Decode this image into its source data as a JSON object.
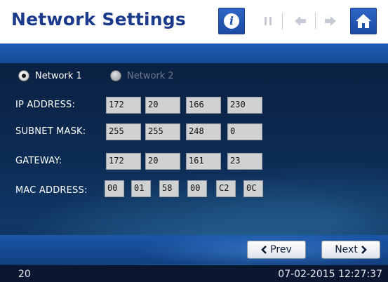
{
  "header": {
    "title": "Network Settings",
    "buttons": [
      {
        "name": "info-icon",
        "glyph": "i",
        "state": "active"
      },
      {
        "name": "pause-icon",
        "state": "disabled"
      },
      {
        "name": "arrow-left-icon",
        "state": "disabled"
      },
      {
        "name": "arrow-right-icon",
        "state": "disabled"
      },
      {
        "name": "home-icon",
        "state": "active"
      }
    ]
  },
  "network": {
    "options": [
      {
        "label": "Network 1",
        "selected": true
      },
      {
        "label": "Network 2",
        "selected": false
      }
    ]
  },
  "fields": {
    "ip": {
      "label": "IP ADDRESS:",
      "octets": [
        "172",
        "20",
        "166",
        "230"
      ]
    },
    "subnet": {
      "label": "SUBNET MASK:",
      "octets": [
        "255",
        "255",
        "248",
        "0"
      ]
    },
    "gateway": {
      "label": "GATEWAY:",
      "octets": [
        "172",
        "20",
        "161",
        "23"
      ]
    },
    "mac": {
      "label": "MAC ADDRESS:",
      "bytes": [
        "00",
        "01",
        "58",
        "00",
        "C2",
        "0C"
      ]
    }
  },
  "footer": {
    "prev_label": "Prev",
    "next_label": "Next"
  },
  "status": {
    "left": "20",
    "datetime": "07-02-2015 12:27:37"
  },
  "colors": {
    "title": "#1b3a8c",
    "accent": "#1a4aa3",
    "field_bg": "#cfd1d3",
    "panel_bg": "#0c2a52"
  }
}
